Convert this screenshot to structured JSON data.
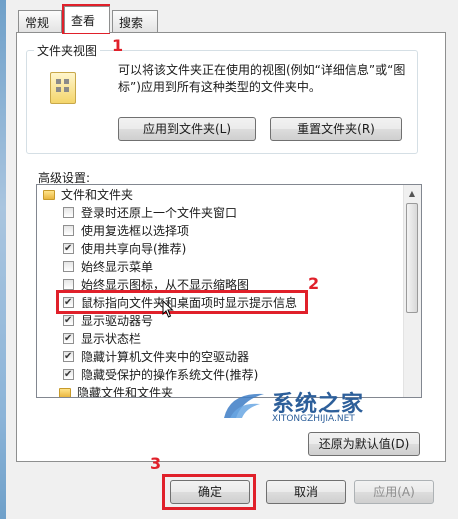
{
  "tabs": [
    {
      "label": "常规"
    },
    {
      "label": "查看"
    },
    {
      "label": "搜索"
    }
  ],
  "folder_view": {
    "title": "文件夹视图",
    "description": "可以将该文件夹正在使用的视图(例如“详细信息”或“图标”)应用到所有这种类型的文件夹中。",
    "apply_button": "应用到文件夹(L)",
    "reset_button": "重置文件夹(R)"
  },
  "advanced": {
    "label": "高级设置:",
    "root_label": "文件和文件夹",
    "items": [
      {
        "label": "登录时还原上一个文件夹窗口",
        "checked": false
      },
      {
        "label": "使用复选框以选择项",
        "checked": false
      },
      {
        "label": "使用共享向导(推荐)",
        "checked": true
      },
      {
        "label": "始终显示菜单",
        "checked": false
      },
      {
        "label": "始终显示图标，从不显示缩略图",
        "checked": false
      },
      {
        "label": "鼠标指向文件夹和桌面项时显示提示信息",
        "checked": true
      },
      {
        "label": "显示驱动器号",
        "checked": true
      },
      {
        "label": "显示状态栏",
        "checked": true
      },
      {
        "label": "隐藏计算机文件夹中的空驱动器",
        "checked": true
      },
      {
        "label": "隐藏受保护的操作系统文件(推荐)",
        "checked": true
      }
    ],
    "subfolder_label": "隐藏文件和文件夹",
    "restore_button": "还原为默认值(D)"
  },
  "buttons": {
    "ok": "确定",
    "cancel": "取消",
    "apply": "应用(A)"
  },
  "annotations": {
    "n1": "1",
    "n2": "2",
    "n3": "3"
  },
  "watermark": {
    "title": "系统之家",
    "url": "XITONGZHIJIA.NET"
  },
  "colors": {
    "annotation_red": "#e0202a",
    "watermark_blue": "#2d5f9a"
  }
}
